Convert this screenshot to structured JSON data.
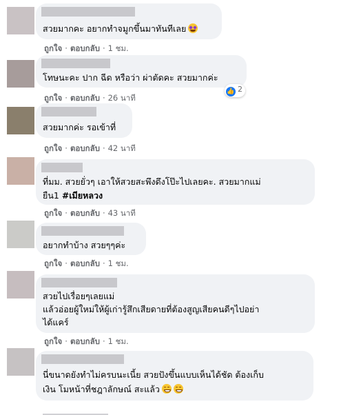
{
  "comments": [
    {
      "text": "สวยมากคะ อยากทำจมูกขึ้นมาทันทีเลย",
      "time": "1 ชม.",
      "avatar": "#c9c2c4"
    },
    {
      "text": "โทษนะคะ ปาก ฉีด หรือว่า ผ่าตัดคะ สวยมากค่ะ",
      "time": "26 นาที",
      "avatar": "#a79c9b",
      "reaction_count": "2"
    },
    {
      "text": "สวยมากค่ะ รอเข้าที่",
      "time": "42 นาที",
      "avatar": "#8a7f6c"
    },
    {
      "text_line1": "ที่มม. สวยยั่วๆ เอาให้สวยสะพึงดึงโป๊ะไปเลยคะ. สวยมากแม่",
      "text_line2": "ยืน1",
      "hashtag": "#เมียหลวง",
      "time": "43 นาที",
      "avatar": "#c9b0a6"
    },
    {
      "text": "อยากทำบ้าง สวยๆๆค่ะ",
      "time": "1 ชม.",
      "avatar": "#cbcbc8"
    },
    {
      "text_line1": "สวยไปเรื่อยๆเลยแม่",
      "text_line2": "แล้วอ่อยผู้ใหม่ให้ผู้เก่ารู้สึกเสียดายที่ต้องสูญเสียคนดีๆไปอย่า",
      "text_line3": "ได้แคร์",
      "time": "1 ชม.",
      "avatar": "#c6bdbf"
    },
    {
      "text_line1": "นี่ขนาดยังทำไม่ครบนะเนี้ย สวยปังขึ้นแบบเห็นได้ชัด ต้องเก็บ",
      "text_line2": "เงิน โมหน้าที่ชฎาลักษณ์ สะแล้ว",
      "avatar": "#c6c2c3"
    }
  ],
  "actions": {
    "like": "ถูกใจ",
    "reply": "ตอบกลับ",
    "separator": "·"
  },
  "emojis": {
    "star_struck": "star-struck-emoji",
    "grin": "grinning-emoji"
  },
  "colors": {
    "bubble": "#f0f2f5",
    "meta": "#65676b",
    "like_badge": "#1877f2"
  }
}
